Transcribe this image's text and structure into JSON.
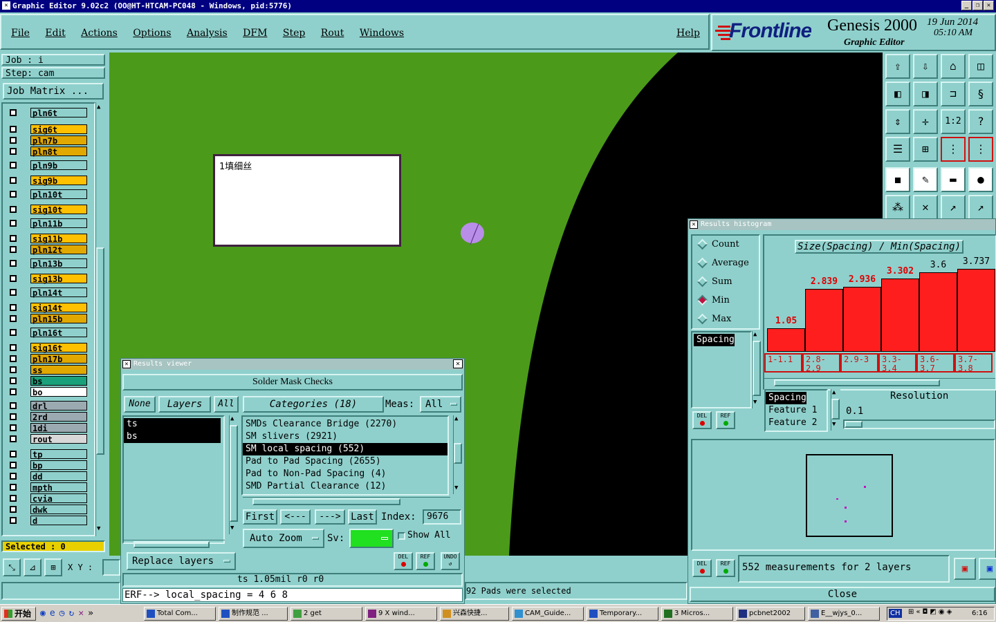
{
  "titlebar": {
    "title": "Graphic Editor 9.02c2 (OO@HT-HTCAM-PC048 - Windows, pid:5776)"
  },
  "menu": {
    "items": [
      "File",
      "Edit",
      "Actions",
      "Options",
      "Analysis",
      "DFM",
      "Step",
      "Rout",
      "Windows"
    ],
    "help": "Help"
  },
  "brand": {
    "logo": "Frontline",
    "product": "Genesis 2000",
    "subtitle": "Graphic Editor",
    "date": "19 Jun 2014",
    "time": "05:10 AM"
  },
  "job": {
    "job_label": "Job : i",
    "step_label": "Step: cam",
    "matrix_button": "Job Matrix ..."
  },
  "layers": [
    {
      "name": "pln6t",
      "color": "#8fd0cc"
    },
    {
      "name": "sig6t",
      "color": "#ffc000"
    },
    {
      "name": "pln7b",
      "color": "#e0a800"
    },
    {
      "name": "pln8t",
      "color": "#e0a800"
    },
    {
      "name": "pln9b",
      "color": "#8fd0cc"
    },
    {
      "name": "sig9b",
      "color": "#ffc000"
    },
    {
      "name": "pln10t",
      "color": "#8fd0cc"
    },
    {
      "name": "sig10t",
      "color": "#ffc000"
    },
    {
      "name": "pln11b",
      "color": "#8fd0cc"
    },
    {
      "name": "sig11b",
      "color": "#ffc000"
    },
    {
      "name": "pln12t",
      "color": "#e0a800"
    },
    {
      "name": "pln13b",
      "color": "#8fd0cc"
    },
    {
      "name": "sig13b",
      "color": "#ffc000"
    },
    {
      "name": "pln14t",
      "color": "#8fd0cc"
    },
    {
      "name": "sig14t",
      "color": "#ffc000"
    },
    {
      "name": "pln15b",
      "color": "#e0a800"
    },
    {
      "name": "pln16t",
      "color": "#8fd0cc"
    },
    {
      "name": "sig16t",
      "color": "#ffc000"
    },
    {
      "name": "pln17b",
      "color": "#e0a800"
    },
    {
      "name": "ss",
      "color": "#e0a800"
    },
    {
      "name": "bs",
      "color": "#1aa07a"
    },
    {
      "name": "bo",
      "color": "#ffffff"
    },
    {
      "name": "drl",
      "color": "#9aaab0"
    },
    {
      "name": "2rd",
      "color": "#9aaab0"
    },
    {
      "name": "1di",
      "color": "#9aaab0"
    },
    {
      "name": "rout",
      "color": "#d8d8d8"
    },
    {
      "name": "tp",
      "color": "#8fd0cc"
    },
    {
      "name": "bp",
      "color": "#8fd0cc"
    },
    {
      "name": "dd",
      "color": "#8fd0cc"
    },
    {
      "name": "mpth",
      "color": "#8fd0cc"
    },
    {
      "name": "cvia",
      "color": "#8fd0cc"
    },
    {
      "name": "dwk",
      "color": "#8fd0cc"
    },
    {
      "name": "d",
      "color": "#8fd0cc"
    }
  ],
  "selected": "Selected : 0",
  "xy_label": "X Y :",
  "note_box": {
    "text": "1填细丝"
  },
  "results_viewer": {
    "title": "Results viewer",
    "header": "Solder Mask Checks",
    "none_btn": "None",
    "layers_btn": "Layers",
    "all_btn": "All",
    "categories_btn": "Categories (18)",
    "meas_label": "Meas:",
    "meas_value": "All",
    "layers_list": [
      "ts",
      "bs"
    ],
    "categories": [
      "SMDs Clearance Bridge (2270)",
      "SM slivers (2921)",
      "SM local spacing (552)",
      "Pad to Pad Spacing (2655)",
      "Pad to Non-Pad Spacing (4)",
      "SMD Partial Clearance (12)"
    ],
    "first": "First",
    "prev": "<---",
    "next": "--->",
    "last": "Last",
    "index_label": "Index:",
    "index_value": "9676",
    "auto_zoom": "Auto Zoom",
    "sv_label": "Sv:",
    "show_all": "Show All",
    "replace_layers": "Replace layers",
    "del": "DEL",
    "ref": "REF",
    "undo": "UNDO",
    "status": "ts 1.05mil  r0  r0",
    "erf": "ERF--> local_spacing = 4 6 8"
  },
  "status_right": "92 Pads were selected",
  "histogram": {
    "title": "Results histogram",
    "options": [
      "Count",
      "Average",
      "Sum",
      "Min",
      "Max"
    ],
    "selected_option": "Min",
    "header": "Size(Spacing) / Min(Spacing)",
    "list": [
      "Spacing"
    ],
    "sublist": [
      "Spacing",
      "Feature 1",
      "Feature 2"
    ],
    "resolution_label": "Resolution",
    "resolution_value": "0.1",
    "measurements": "552 measurements for 2 layers",
    "close": "Close",
    "del": "DEL",
    "ref": "REF"
  },
  "chart_data": {
    "type": "bar",
    "categories": [
      "1-1.1",
      "2.8-2.9",
      "2.9-3",
      "3.3-3.4",
      "3.6-3.7",
      "3.7-3.8"
    ],
    "values": [
      1.05,
      2.839,
      2.936,
      3.302,
      3.6,
      3.737
    ],
    "value_labels": [
      "1.05",
      "2.839",
      "2.936",
      "3.302",
      "3.6",
      "3.737"
    ],
    "title": "Size(Spacing) / Min(Spacing)",
    "ylim": [
      0,
      4
    ]
  },
  "taskbar": {
    "start": "开始",
    "tasks": [
      "Total Com...",
      "制作规范 ...",
      "2 get",
      "9 X wind...",
      "兴森快捷...",
      "CAM_Guide...",
      "Temporary...",
      "3 Micros...",
      "pcbnet2002",
      "E__wjys_0..."
    ],
    "lang": "CH",
    "clock": "6:16"
  }
}
